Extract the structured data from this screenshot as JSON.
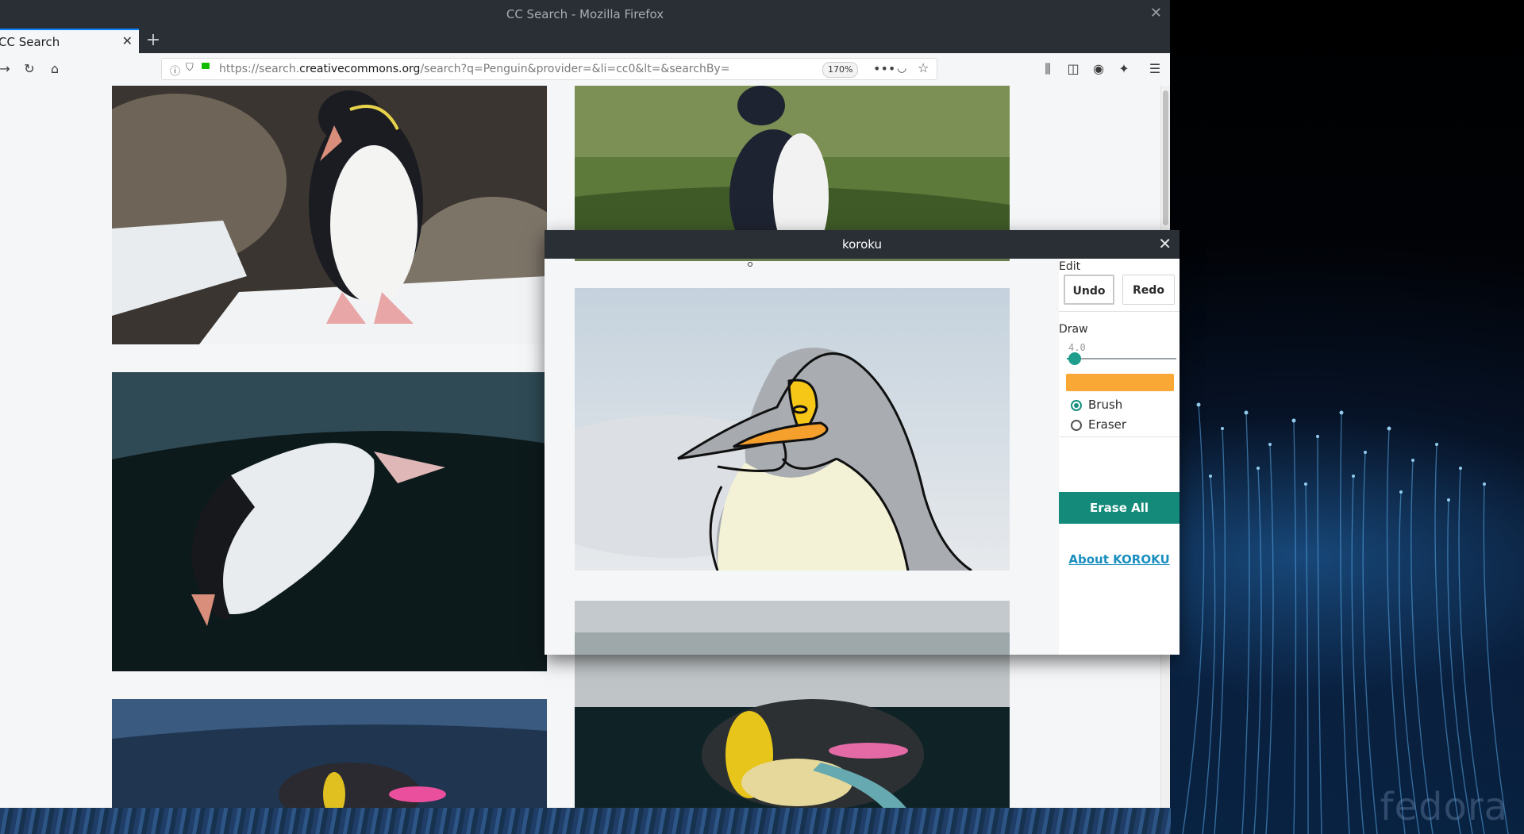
{
  "firefox": {
    "window_title": "CC Search - Mozilla Firefox",
    "tab_label": "CC Search",
    "url_prefix": "https://search.",
    "url_domain": "creativecommons.org",
    "url_path": "/search?q=Penguin&provider=&li=cc0&lt=&searchBy=",
    "zoom": "170%"
  },
  "koroku": {
    "title": "koroku",
    "edit_label": "Edit",
    "undo_label": "Undo",
    "redo_label": "Redo",
    "draw_label": "Draw",
    "brush_size": "4.0",
    "brush_size_fraction": 0.04,
    "brush_color": "#f9a835",
    "brush_label": "Brush",
    "eraser_label": "Eraser",
    "selected_tool": "Brush",
    "erase_all_label": "Erase All",
    "about_label": "About KOROKU"
  },
  "desktop": {
    "watermark": "fedora"
  },
  "icons": [
    "close-icon",
    "new-tab-icon",
    "back-icon",
    "reload-icon",
    "home-icon",
    "info-icon",
    "shield-icon",
    "lock-icon",
    "more-icon",
    "pocket-icon",
    "bookmark-star-icon",
    "library-icon",
    "sidebar-icon",
    "account-icon",
    "extension-icon",
    "menu-icon"
  ],
  "colors": {
    "accent": "#138a7a",
    "titlebar": "#2a2f35",
    "link": "#1a8fbf"
  }
}
